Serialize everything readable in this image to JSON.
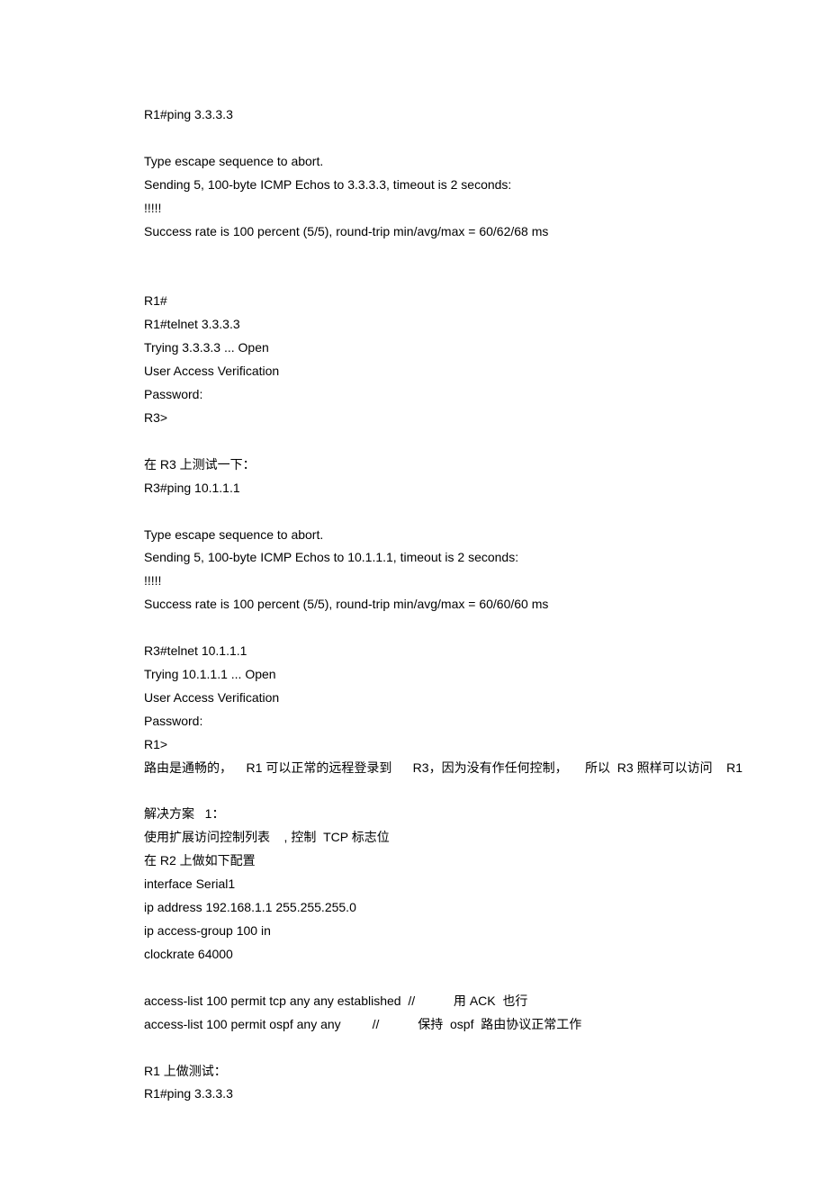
{
  "lines": [
    "R1#ping 3.3.3.3",
    "",
    "Type escape sequence to abort.",
    "Sending 5, 100-byte ICMP Echos to 3.3.3.3, timeout is 2 seconds:",
    "!!!!!",
    "Success rate is 100 percent (5/5), round-trip min/avg/max = 60/62/68 ms",
    "",
    "",
    "R1#",
    "R1#telnet 3.3.3.3",
    "Trying 3.3.3.3 ... Open",
    "User Access Verification",
    "Password:",
    "R3>",
    "",
    "在 R3 上测试一下：",
    "R3#ping 10.1.1.1",
    "",
    "Type escape sequence to abort.",
    "Sending 5, 100-byte ICMP Echos to 10.1.1.1, timeout is 2 seconds:",
    "!!!!!",
    "Success rate is 100 percent (5/5), round-trip min/avg/max = 60/60/60 ms",
    "",
    "R3#telnet 10.1.1.1",
    "Trying 10.1.1.1 ... Open",
    "User Access Verification",
    "Password:",
    "R1>",
    "路由是通畅的，    R1 可以正常的远程登录到      R3，因为没有作任何控制，     所以  R3 照样可以访问    R1",
    "",
    "解决方案   1：",
    "使用扩展访问控制列表    , 控制  TCP 标志位",
    "在 R2 上做如下配置",
    "interface Serial1",
    "ip address 192.168.1.1 255.255.255.0",
    "ip access-group 100 in",
    "clockrate 64000",
    "",
    "access-list 100 permit tcp any any established  //           用 ACK  也行",
    "access-list 100 permit ospf any any         //           保持  ospf  路由协议正常工作",
    "",
    "R1 上做测试：",
    "R1#ping 3.3.3.3"
  ]
}
